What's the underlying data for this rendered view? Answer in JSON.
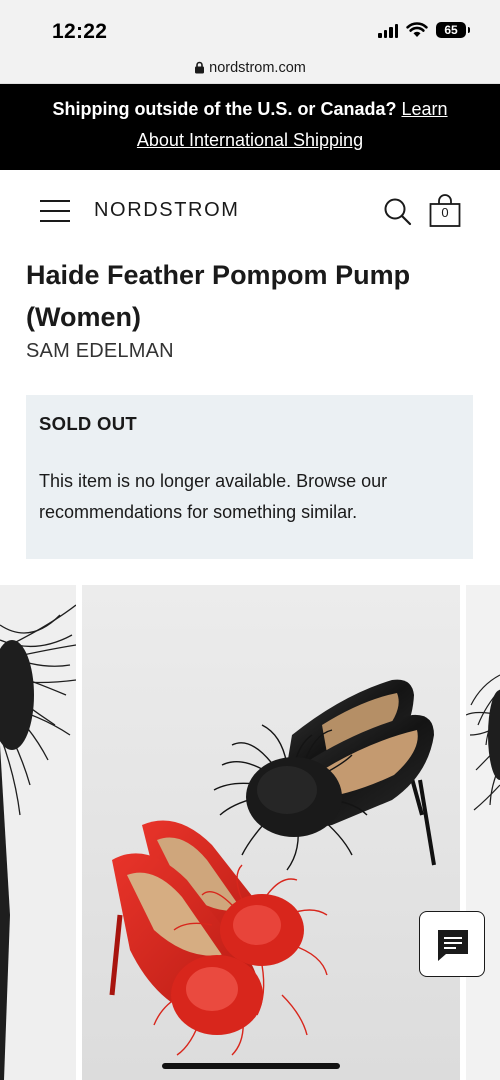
{
  "status_bar": {
    "time": "12:22",
    "battery": "65"
  },
  "browser": {
    "url": "nordstrom.com"
  },
  "shipping_banner": {
    "text": "Shipping outside of the U.S. or Canada?",
    "link_label": "Learn About International Shipping"
  },
  "header": {
    "logo": "NORDSTROM",
    "bag_count": "0"
  },
  "product": {
    "title": "Haide Feather Pompom Pump (Women)",
    "brand": "SAM EDELMAN"
  },
  "sold_out": {
    "heading": "SOLD OUT",
    "message": "This item is no longer available. Browse our recommendations for something similar."
  },
  "colors": {
    "banner_bg": "#000000",
    "soldout_bg": "#ebf0f3",
    "shoe_red": "#d8261c",
    "shoe_black": "#1c1c1c"
  },
  "icons": {
    "menu": "hamburger-menu-icon",
    "search": "search-icon",
    "bag": "shopping-bag-icon",
    "chat": "chat-icon",
    "lock": "lock-icon"
  }
}
